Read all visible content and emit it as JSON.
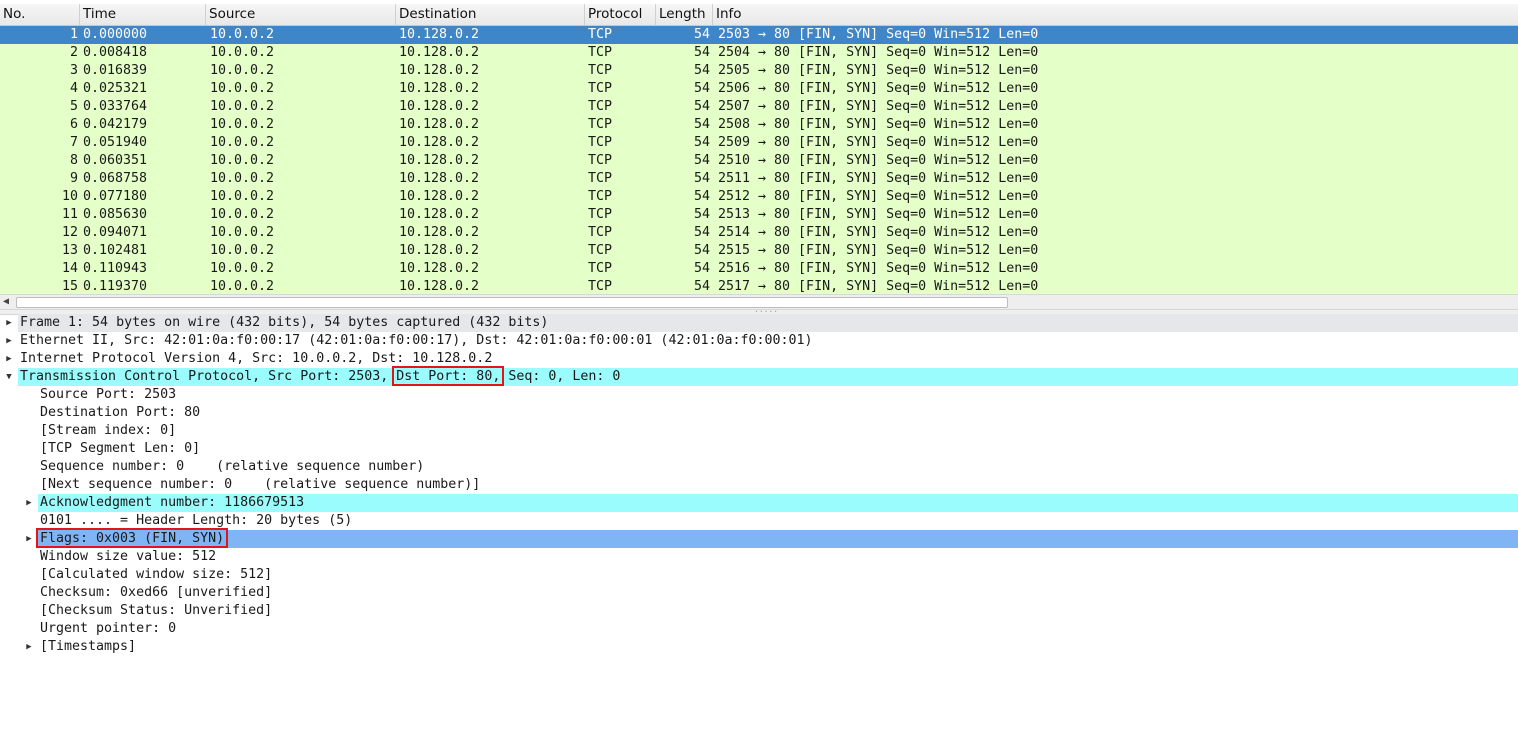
{
  "columns": [
    "No.",
    "Time",
    "Source",
    "Destination",
    "Protocol",
    "Length",
    "Info"
  ],
  "packets": [
    {
      "no": "1",
      "time": "0.000000",
      "src": "10.0.0.2",
      "dst": "10.128.0.2",
      "proto": "TCP",
      "len": "54",
      "info": "2503 → 80 [FIN, SYN] Seq=0 Win=512 Len=0"
    },
    {
      "no": "2",
      "time": "0.008418",
      "src": "10.0.0.2",
      "dst": "10.128.0.2",
      "proto": "TCP",
      "len": "54",
      "info": "2504 → 80 [FIN, SYN] Seq=0 Win=512 Len=0"
    },
    {
      "no": "3",
      "time": "0.016839",
      "src": "10.0.0.2",
      "dst": "10.128.0.2",
      "proto": "TCP",
      "len": "54",
      "info": "2505 → 80 [FIN, SYN] Seq=0 Win=512 Len=0"
    },
    {
      "no": "4",
      "time": "0.025321",
      "src": "10.0.0.2",
      "dst": "10.128.0.2",
      "proto": "TCP",
      "len": "54",
      "info": "2506 → 80 [FIN, SYN] Seq=0 Win=512 Len=0"
    },
    {
      "no": "5",
      "time": "0.033764",
      "src": "10.0.0.2",
      "dst": "10.128.0.2",
      "proto": "TCP",
      "len": "54",
      "info": "2507 → 80 [FIN, SYN] Seq=0 Win=512 Len=0"
    },
    {
      "no": "6",
      "time": "0.042179",
      "src": "10.0.0.2",
      "dst": "10.128.0.2",
      "proto": "TCP",
      "len": "54",
      "info": "2508 → 80 [FIN, SYN] Seq=0 Win=512 Len=0"
    },
    {
      "no": "7",
      "time": "0.051940",
      "src": "10.0.0.2",
      "dst": "10.128.0.2",
      "proto": "TCP",
      "len": "54",
      "info": "2509 → 80 [FIN, SYN] Seq=0 Win=512 Len=0"
    },
    {
      "no": "8",
      "time": "0.060351",
      "src": "10.0.0.2",
      "dst": "10.128.0.2",
      "proto": "TCP",
      "len": "54",
      "info": "2510 → 80 [FIN, SYN] Seq=0 Win=512 Len=0"
    },
    {
      "no": "9",
      "time": "0.068758",
      "src": "10.0.0.2",
      "dst": "10.128.0.2",
      "proto": "TCP",
      "len": "54",
      "info": "2511 → 80 [FIN, SYN] Seq=0 Win=512 Len=0"
    },
    {
      "no": "10",
      "time": "0.077180",
      "src": "10.0.0.2",
      "dst": "10.128.0.2",
      "proto": "TCP",
      "len": "54",
      "info": "2512 → 80 [FIN, SYN] Seq=0 Win=512 Len=0"
    },
    {
      "no": "11",
      "time": "0.085630",
      "src": "10.0.0.2",
      "dst": "10.128.0.2",
      "proto": "TCP",
      "len": "54",
      "info": "2513 → 80 [FIN, SYN] Seq=0 Win=512 Len=0"
    },
    {
      "no": "12",
      "time": "0.094071",
      "src": "10.0.0.2",
      "dst": "10.128.0.2",
      "proto": "TCP",
      "len": "54",
      "info": "2514 → 80 [FIN, SYN] Seq=0 Win=512 Len=0"
    },
    {
      "no": "13",
      "time": "0.102481",
      "src": "10.0.0.2",
      "dst": "10.128.0.2",
      "proto": "TCP",
      "len": "54",
      "info": "2515 → 80 [FIN, SYN] Seq=0 Win=512 Len=0"
    },
    {
      "no": "14",
      "time": "0.110943",
      "src": "10.0.0.2",
      "dst": "10.128.0.2",
      "proto": "TCP",
      "len": "54",
      "info": "2516 → 80 [FIN, SYN] Seq=0 Win=512 Len=0"
    },
    {
      "no": "15",
      "time": "0.119370",
      "src": "10.0.0.2",
      "dst": "10.128.0.2",
      "proto": "TCP",
      "len": "54",
      "info": "2517 → 80 [FIN, SYN] Seq=0 Win=512 Len=0"
    }
  ],
  "selected_packet": "1",
  "details": [
    {
      "text": "Frame 1: 54 bytes on wire (432 bits), 54 bytes captured (432 bits)",
      "level": 0,
      "arrow": "collapsed",
      "bg": "gray"
    },
    {
      "text": "Ethernet II, Src: 42:01:0a:f0:00:17 (42:01:0a:f0:00:17), Dst: 42:01:0a:f0:00:01 (42:01:0a:f0:00:01)",
      "level": 0,
      "arrow": "collapsed",
      "bg": "none"
    },
    {
      "text": "Internet Protocol Version 4, Src: 10.0.0.2, Dst: 10.128.0.2",
      "level": 0,
      "arrow": "collapsed",
      "bg": "none"
    },
    {
      "text": "Transmission Control Protocol, Src Port: 2503, Dst Port: 80, Seq: 0, Len: 0",
      "level": 0,
      "arrow": "expanded",
      "bg": "cyan"
    },
    {
      "text": "Source Port: 2503",
      "level": 1,
      "arrow": "none",
      "bg": "none"
    },
    {
      "text": "Destination Port: 80",
      "level": 1,
      "arrow": "none",
      "bg": "none"
    },
    {
      "text": "[Stream index: 0]",
      "level": 1,
      "arrow": "none",
      "bg": "none"
    },
    {
      "text": "[TCP Segment Len: 0]",
      "level": 1,
      "arrow": "none",
      "bg": "none"
    },
    {
      "text": "Sequence number: 0    (relative sequence number)",
      "level": 1,
      "arrow": "none",
      "bg": "none"
    },
    {
      "text": "[Next sequence number: 0    (relative sequence number)]",
      "level": 1,
      "arrow": "none",
      "bg": "none"
    },
    {
      "text": "Acknowledgment number: 1186679513",
      "level": 1,
      "arrow": "collapsed",
      "bg": "cyan"
    },
    {
      "text": "0101 .... = Header Length: 20 bytes (5)",
      "level": 1,
      "arrow": "none",
      "bg": "none"
    },
    {
      "text": "Flags: 0x003 (FIN, SYN)",
      "level": 1,
      "arrow": "collapsed",
      "bg": "blue"
    },
    {
      "text": "Window size value: 512",
      "level": 1,
      "arrow": "none",
      "bg": "none"
    },
    {
      "text": "[Calculated window size: 512]",
      "level": 1,
      "arrow": "none",
      "bg": "none"
    },
    {
      "text": "Checksum: 0xed66 [unverified]",
      "level": 1,
      "arrow": "none",
      "bg": "none"
    },
    {
      "text": "[Checksum Status: Unverified]",
      "level": 1,
      "arrow": "none",
      "bg": "none"
    },
    {
      "text": "Urgent pointer: 0",
      "level": 1,
      "arrow": "none",
      "bg": "none"
    },
    {
      "text": "[Timestamps]",
      "level": 1,
      "arrow": "collapsed",
      "bg": "none"
    }
  ],
  "highlights": [
    {
      "row": 3,
      "label": "Dst Port: 80,"
    },
    {
      "row": 12,
      "label": "Flags: 0x003 (FIN, SYN)"
    }
  ],
  "colors": {
    "row_bg": "#e4ffc7",
    "selected_bg": "#3e86c8",
    "cyan": "#9afcfc",
    "blue": "#7fb5f5",
    "gray": "#e6e7ea",
    "highlight_border": "#e0161b"
  }
}
